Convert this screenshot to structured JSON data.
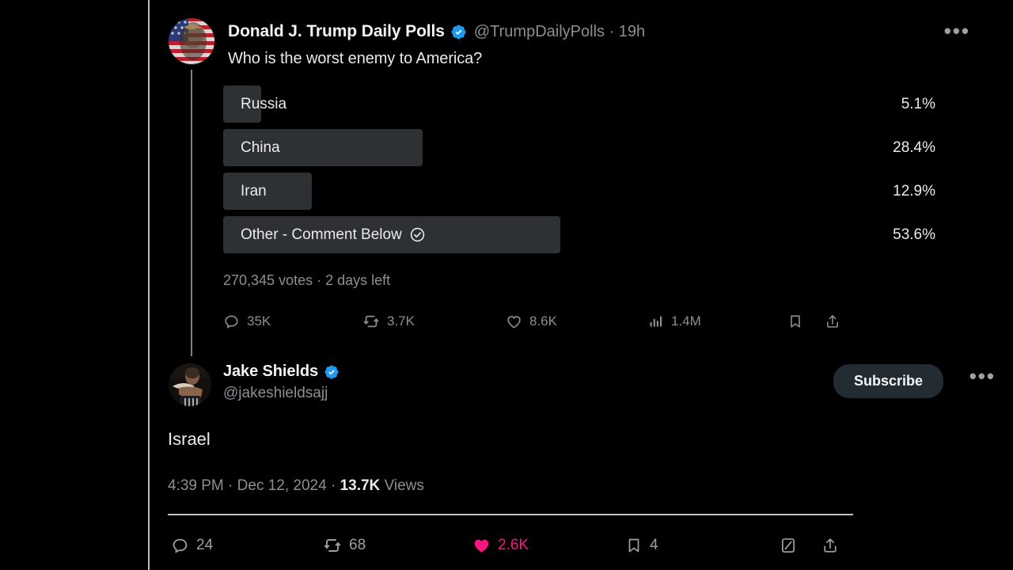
{
  "app": "twitter-thread-view",
  "parent_tweet": {
    "display_name": "Donald J. Trump Daily Polls",
    "verified": true,
    "handle": "@TrumpDailyPolls",
    "separator": "·",
    "timestamp": "19h",
    "more_icon": "more-horizontal-icon",
    "question": "Who is the worst enemy to America?",
    "poll": {
      "options": [
        {
          "label": "Russia",
          "percent": "5.1%",
          "value": 5.1,
          "winner": false
        },
        {
          "label": "China",
          "percent": "28.4%",
          "value": 28.4,
          "winner": false
        },
        {
          "label": "Iran",
          "percent": "12.9%",
          "value": 12.9,
          "winner": false
        },
        {
          "label": "Other - Comment Below",
          "percent": "53.6%",
          "value": 53.6,
          "winner": true
        }
      ],
      "meta": "270,345 votes · 2 days left",
      "votes": "270,345 votes",
      "time_left": "2 days left"
    },
    "actions": [
      {
        "icon": "reply-icon",
        "count": "35K"
      },
      {
        "icon": "retweet-icon",
        "count": "3.7K"
      },
      {
        "icon": "heart-icon",
        "count": "8.6K"
      },
      {
        "icon": "views-chart-icon",
        "count": "1.4M"
      },
      {
        "icon": "bookmark-icon",
        "count": ""
      },
      {
        "icon": "share-icon",
        "count": ""
      }
    ]
  },
  "main_tweet": {
    "display_name": "Jake Shields",
    "verified": true,
    "handle": "@jakeshieldsajj",
    "subscribe_label": "Subscribe",
    "more_icon": "more-horizontal-icon",
    "body": "Israel",
    "time": "4:39 PM",
    "date": "Dec 12, 2024",
    "views_count": "13.7K",
    "views_label": "Views",
    "separator": "·",
    "actions": [
      {
        "icon": "reply-icon",
        "count": "24",
        "active": false
      },
      {
        "icon": "retweet-icon",
        "count": "68",
        "active": false
      },
      {
        "icon": "heart-icon-filled",
        "count": "2.6K",
        "active": true
      },
      {
        "icon": "bookmark-icon",
        "count": "4",
        "active": false
      },
      {
        "icon": "grok-icon",
        "count": "",
        "active": false
      },
      {
        "icon": "share-icon",
        "count": "",
        "active": false
      }
    ]
  },
  "colors": {
    "background": "#000000",
    "text_primary": "#e7e9ea",
    "text_secondary": "#8b8f92",
    "poll_bar": "#2d3134",
    "verified_blue": "#1d9bf0",
    "like_pink": "#f91880",
    "subscribe_bg": "#242c33"
  }
}
